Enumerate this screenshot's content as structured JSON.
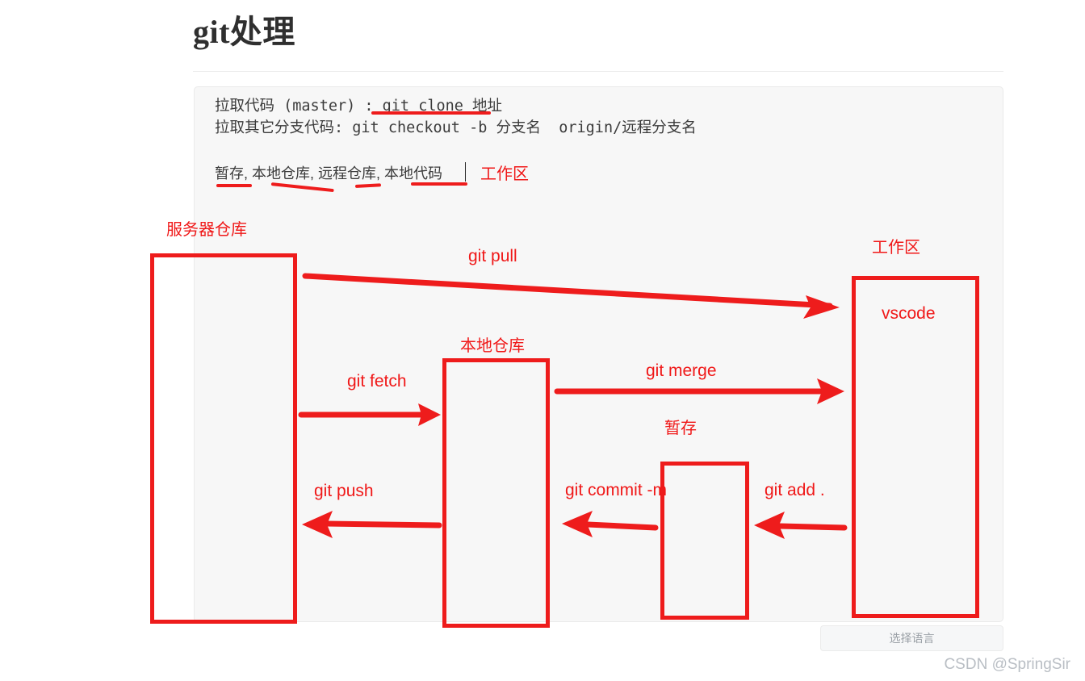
{
  "page": {
    "title": "git处理"
  },
  "note": {
    "line1": "拉取代码 (master) : git clone 地址",
    "line2": "拉取其它分支代码: git checkout -b 分支名  origin/远程分支名",
    "line3": "暂存, 本地仓库, 远程仓库, 本地代码",
    "annotation": "工作区"
  },
  "diagram": {
    "boxes": [
      {
        "id": "server",
        "label": "服务器仓库",
        "inner_text": ""
      },
      {
        "id": "local",
        "label": "本地仓库",
        "inner_text": ""
      },
      {
        "id": "stage",
        "label": "暂存",
        "inner_text": ""
      },
      {
        "id": "vscode",
        "label": "工作区",
        "inner_text": "vscode"
      }
    ],
    "arrows": [
      {
        "id": "git-pull",
        "label": "git pull",
        "from": "server",
        "to": "vscode",
        "direction": "right"
      },
      {
        "id": "git-fetch",
        "label": "git fetch",
        "from": "server",
        "to": "local",
        "direction": "right"
      },
      {
        "id": "git-merge",
        "label": "git merge",
        "from": "local",
        "to": "vscode",
        "direction": "right"
      },
      {
        "id": "git-push",
        "label": "git push",
        "from": "local",
        "to": "server",
        "direction": "left"
      },
      {
        "id": "git-commit",
        "label": "git commit -m",
        "from": "stage",
        "to": "local",
        "direction": "left"
      },
      {
        "id": "git-add",
        "label": "git add .",
        "from": "vscode",
        "to": "stage",
        "direction": "left"
      }
    ]
  },
  "footer": {
    "language_button": "选择语言",
    "watermark": "CSDN @SpringSir"
  },
  "colors": {
    "annotation_red": "#ee1c1c",
    "panel_background": "#f7f7f7",
    "title_text": "#2f2f2f",
    "watermark_text": "#b9bec4"
  },
  "chart_data": {
    "type": "diagram",
    "title": "git处理",
    "nodes": [
      "服务器仓库",
      "本地仓库",
      "暂存",
      "工作区 (vscode)"
    ],
    "edges": [
      {
        "label": "git pull",
        "source": "服务器仓库",
        "target": "工作区 (vscode)"
      },
      {
        "label": "git fetch",
        "source": "服务器仓库",
        "target": "本地仓库"
      },
      {
        "label": "git merge",
        "source": "本地仓库",
        "target": "工作区 (vscode)"
      },
      {
        "label": "git push",
        "source": "本地仓库",
        "target": "服务器仓库"
      },
      {
        "label": "git commit -m",
        "source": "暂存",
        "target": "本地仓库"
      },
      {
        "label": "git add .",
        "source": "工作区 (vscode)",
        "target": "暂存"
      }
    ]
  }
}
